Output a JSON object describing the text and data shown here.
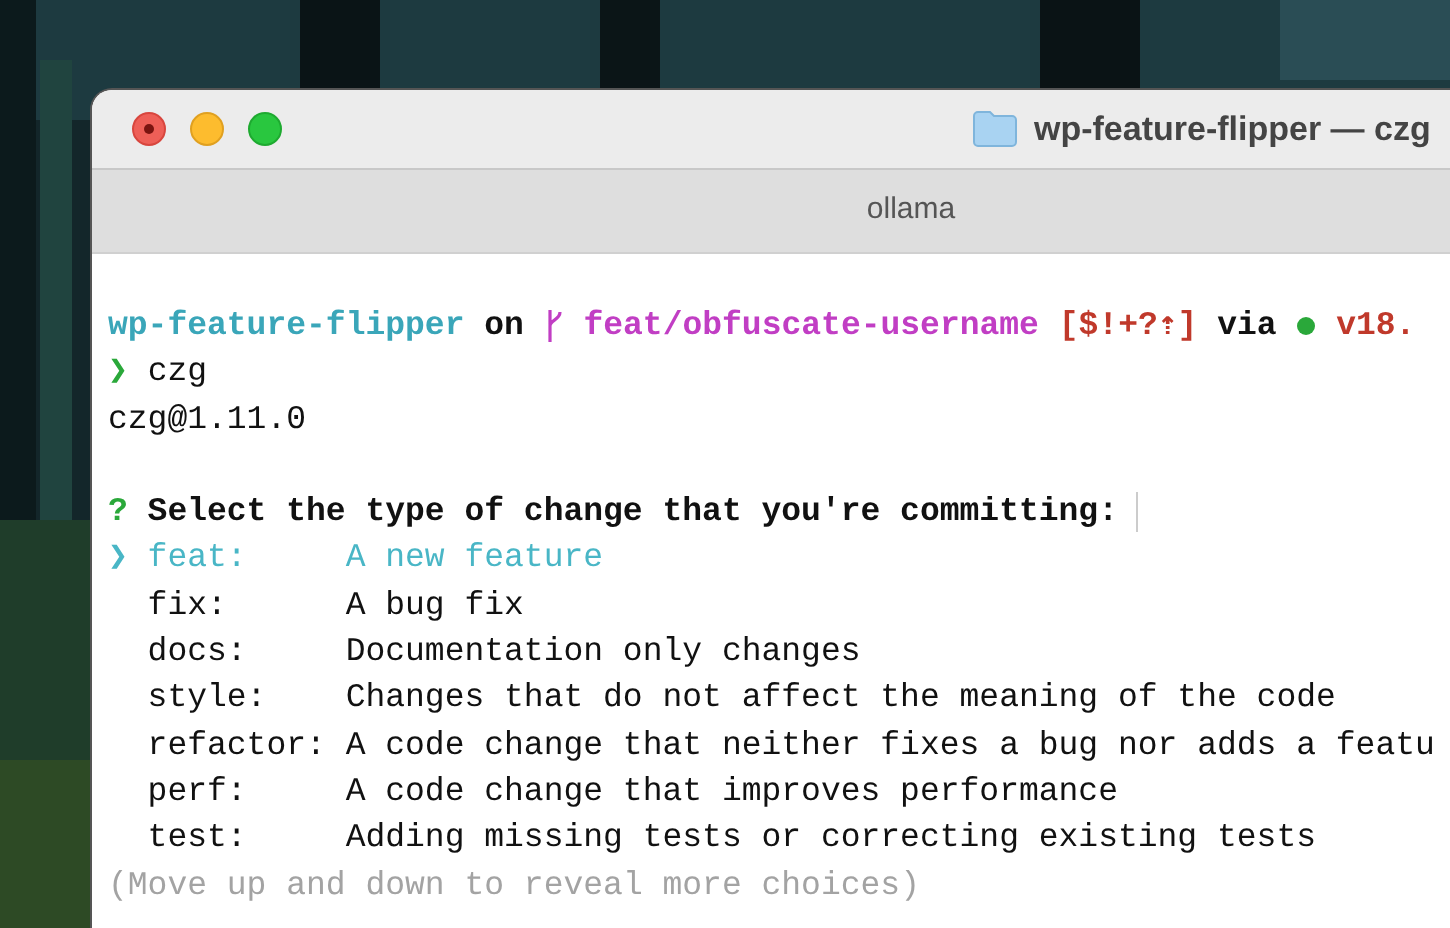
{
  "window": {
    "title": "wp-feature-flipper — czg",
    "tab": "ollama"
  },
  "prompt": {
    "directory": "wp-feature-flipper",
    "on": "on",
    "branch": "feat/obfuscate-username",
    "status": "[$!+?⇡]",
    "via": "via",
    "version": "v18."
  },
  "command": {
    "symbol": "❯",
    "text": "czg"
  },
  "output": "czg@1.11.0",
  "question": {
    "mark": "?",
    "text": "Select the type of change that you're committing:",
    "pointer": "❯"
  },
  "choices": [
    {
      "type": "feat:",
      "description": "A new feature",
      "selected": true
    },
    {
      "type": "fix:",
      "description": "A bug fix",
      "selected": false
    },
    {
      "type": "docs:",
      "description": "Documentation only changes",
      "selected": false
    },
    {
      "type": "style:",
      "description": "Changes that do not affect the meaning of the code",
      "selected": false
    },
    {
      "type": "refactor:",
      "description": "A code change that neither fixes a bug nor adds a featu",
      "selected": false
    },
    {
      "type": "perf:",
      "description": "A code change that improves performance",
      "selected": false
    },
    {
      "type": "test:",
      "description": "Adding missing tests or correcting existing tests",
      "selected": false
    }
  ],
  "hint": "(Move up and down to reveal more choices)"
}
